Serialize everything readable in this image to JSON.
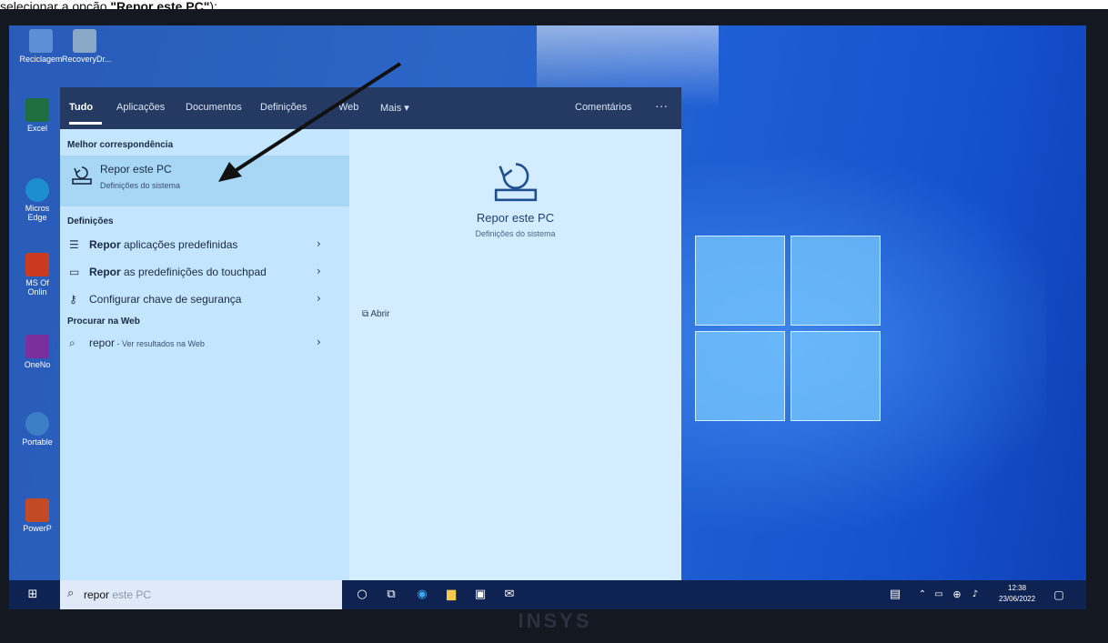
{
  "caption": {
    "prefix": "selecionar a opção ",
    "bold": "\"Repor este PC\"",
    "suffix": ");"
  },
  "desktop": {
    "icons": [
      {
        "label": "Reciclagem",
        "icon": "recycle-bin-icon"
      },
      {
        "label": "RecoveryDr...",
        "icon": "recovery-drive-icon"
      },
      {
        "label": "Excel",
        "icon": "excel-icon"
      },
      {
        "label": "Micros Edge",
        "icon": "edge-icon"
      },
      {
        "label": "MS Of Onlin",
        "icon": "office-icon"
      },
      {
        "label": "OneNo",
        "icon": "onenote-icon"
      },
      {
        "label": "Portable",
        "icon": "portable-icon"
      },
      {
        "label": "PowerP",
        "icon": "powerpoint-icon"
      }
    ]
  },
  "search": {
    "tabs": [
      "Tudo",
      "Aplicações",
      "Documentos",
      "Definições",
      "Web",
      "Mais ▾"
    ],
    "feedback": "Comentários",
    "more": "···",
    "best_match_header": "Melhor correspondência",
    "best_match": {
      "title": "Repor este PC",
      "subtitle": "Definições do sistema"
    },
    "settings_header": "Definições",
    "settings_items": [
      {
        "bold": "Repor",
        "rest": " aplicações predefinidas",
        "icon": "list-icon"
      },
      {
        "bold": "Repor",
        "rest": " as predefinições do touchpad",
        "icon": "touchpad-icon"
      },
      {
        "bold": "",
        "rest": "Configurar chave de segurança",
        "icon": "key-icon"
      }
    ],
    "web_header": "Procurar na Web",
    "web_item": {
      "query": "repor",
      "suffix": " - Ver resultados na Web"
    },
    "preview": {
      "title": "Repor este PC",
      "subtitle": "Definições do sistema",
      "open_label": "Abrir"
    }
  },
  "taskbar": {
    "search_text": "repor",
    "search_hint": " este PC",
    "time": "12:38",
    "date": "23/06/2022"
  },
  "monitor_brand": "INSYS"
}
